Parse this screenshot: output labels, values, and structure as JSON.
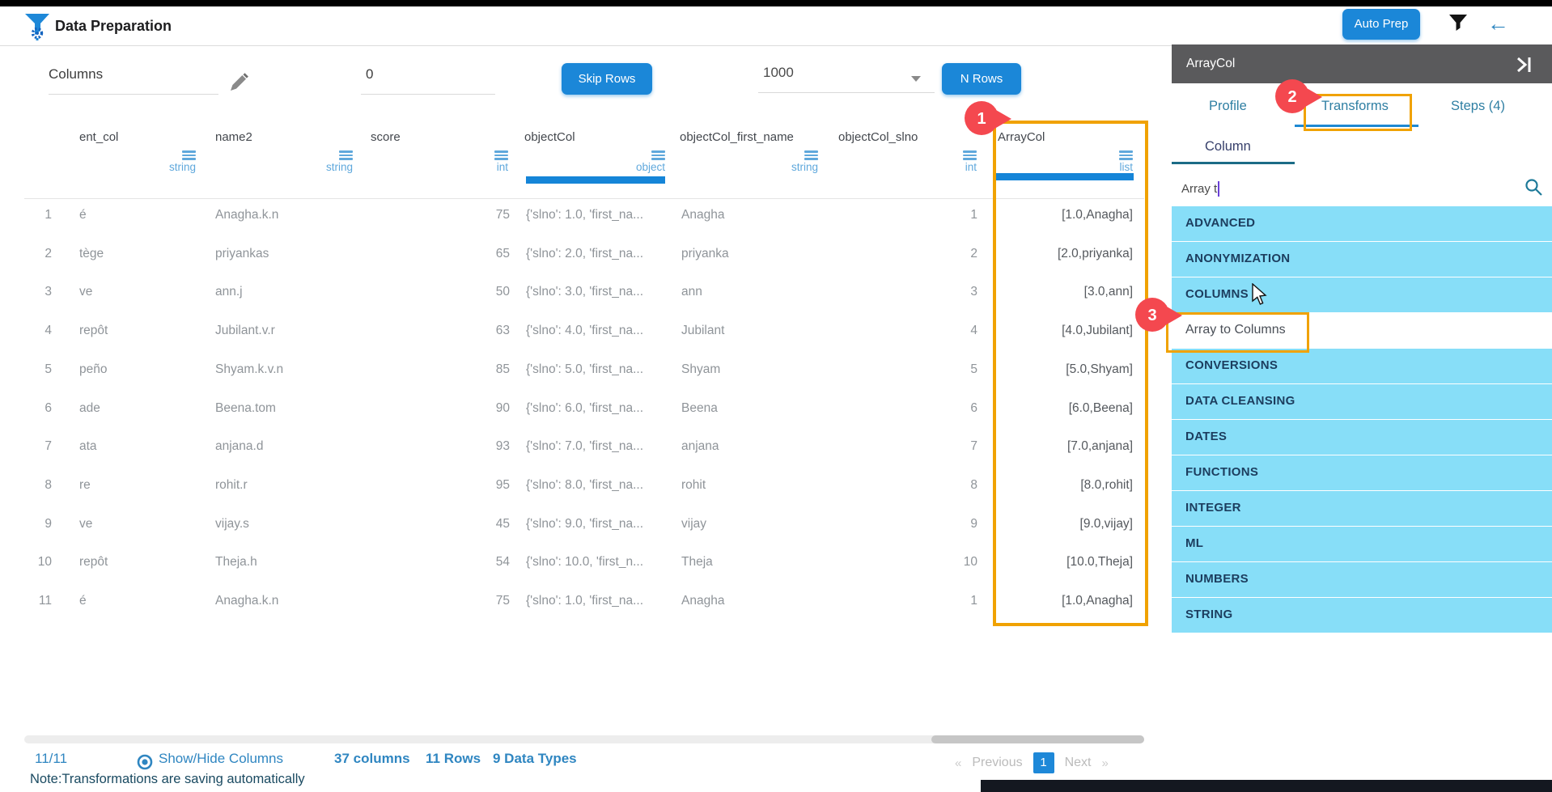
{
  "header": {
    "title": "Data Preparation",
    "auto_prep_label": "Auto Prep",
    "back_arrow": "←"
  },
  "controls": {
    "columns_value": "Columns",
    "skip_rows_value": "0",
    "skip_rows_button": "Skip Rows",
    "page_size_value": "1000",
    "n_rows_button": "N Rows"
  },
  "table": {
    "columns": [
      {
        "name": "ent_col",
        "type": "string"
      },
      {
        "name": "name2",
        "type": "string"
      },
      {
        "name": "score",
        "type": "int"
      },
      {
        "name": "objectCol",
        "type": "object"
      },
      {
        "name": "objectCol_first_name",
        "type": "string"
      },
      {
        "name": "objectCol_slno",
        "type": "int"
      },
      {
        "name": "ArrayCol",
        "type": "list"
      }
    ],
    "rows": [
      {
        "num": "1",
        "ent": "é",
        "name2": "Anagha.k.n",
        "score": "75",
        "obj": "{'slno': 1.0, 'first_na...",
        "fn": "Anagha",
        "slno": "1",
        "arr": "[1.0,Anagha]"
      },
      {
        "num": "2",
        "ent": "tège",
        "name2": "priyankas",
        "score": "65",
        "obj": "{'slno': 2.0, 'first_na...",
        "fn": "priyanka",
        "slno": "2",
        "arr": "[2.0,priyanka]"
      },
      {
        "num": "3",
        "ent": "ve",
        "name2": "ann.j",
        "score": "50",
        "obj": "{'slno': 3.0, 'first_na...",
        "fn": "ann",
        "slno": "3",
        "arr": "[3.0,ann]"
      },
      {
        "num": "4",
        "ent": "repôt",
        "name2": "Jubilant.v.r",
        "score": "63",
        "obj": "{'slno': 4.0, 'first_na...",
        "fn": "Jubilant",
        "slno": "4",
        "arr": "[4.0,Jubilant]"
      },
      {
        "num": "5",
        "ent": "peño",
        "name2": "Shyam.k.v.n",
        "score": "85",
        "obj": "{'slno': 5.0, 'first_na...",
        "fn": "Shyam",
        "slno": "5",
        "arr": "[5.0,Shyam]"
      },
      {
        "num": "6",
        "ent": "ade",
        "name2": "Beena.tom",
        "score": "90",
        "obj": "{'slno': 6.0, 'first_na...",
        "fn": "Beena",
        "slno": "6",
        "arr": "[6.0,Beena]"
      },
      {
        "num": "7",
        "ent": "ata",
        "name2": "anjana.d",
        "score": "93",
        "obj": "{'slno': 7.0, 'first_na...",
        "fn": "anjana",
        "slno": "7",
        "arr": "[7.0,anjana]"
      },
      {
        "num": "8",
        "ent": "re",
        "name2": "rohit.r",
        "score": "95",
        "obj": "{'slno': 8.0, 'first_na...",
        "fn": "rohit",
        "slno": "8",
        "arr": "[8.0,rohit]"
      },
      {
        "num": "9",
        "ent": "ve",
        "name2": "vijay.s",
        "score": "45",
        "obj": "{'slno': 9.0, 'first_na...",
        "fn": "vijay",
        "slno": "9",
        "arr": "[9.0,vijay]"
      },
      {
        "num": "10",
        "ent": "repôt",
        "name2": "Theja.h",
        "score": "54",
        "obj": "{'slno': 10.0, 'first_n...",
        "fn": "Theja",
        "slno": "10",
        "arr": "[10.0,Theja]"
      },
      {
        "num": "11",
        "ent": "é",
        "name2": "Anagha.k.n",
        "score": "75",
        "obj": "{'slno': 1.0, 'first_na...",
        "fn": "Anagha",
        "slno": "1",
        "arr": "[1.0,Anagha]"
      }
    ]
  },
  "annotations": {
    "badge1": "1",
    "badge2": "2",
    "badge3": "3"
  },
  "sidebar": {
    "title": "ArrayCol",
    "tabs": {
      "profile": "Profile",
      "transforms": "Transforms",
      "steps": "Steps (4)"
    },
    "subtab": "Column",
    "search_value": "Array t",
    "items": [
      {
        "label": "ADVANCED",
        "style": "blue"
      },
      {
        "label": "ANONYMIZATION",
        "style": "blue"
      },
      {
        "label": "COLUMNS",
        "style": "blue"
      },
      {
        "label": "Array to Columns",
        "style": "white"
      },
      {
        "label": "CONVERSIONS",
        "style": "blue"
      },
      {
        "label": "DATA CLEANSING",
        "style": "blue"
      },
      {
        "label": "DATES",
        "style": "blue"
      },
      {
        "label": "FUNCTIONS",
        "style": "blue"
      },
      {
        "label": "INTEGER",
        "style": "blue"
      },
      {
        "label": "ML",
        "style": "blue"
      },
      {
        "label": "NUMBERS",
        "style": "blue"
      },
      {
        "label": "STRING",
        "style": "blue"
      }
    ]
  },
  "footer": {
    "count": "11/11",
    "show_hide": "Show/Hide Columns",
    "columns_stat": "37 columns",
    "rows_stat": "11 Rows",
    "types_stat": "9 Data Types",
    "note": "Note:Transformations are saving automatically",
    "pagination": {
      "prev_arrow": "«",
      "prev": "Previous",
      "page": "1",
      "next": "Next",
      "next_arrow": "»"
    }
  },
  "colors": {
    "primary_blue": "#1B87D8",
    "link_blue": "#2F86C1",
    "type_label_blue": "#5FA8DC",
    "list_row_blue": "#87DEF8",
    "highlight_orange": "#F0A202",
    "badge_red": "#F4484F",
    "sidebar_header_gray": "#5A5A5C",
    "profile_bar_blue": "#1585D8"
  }
}
